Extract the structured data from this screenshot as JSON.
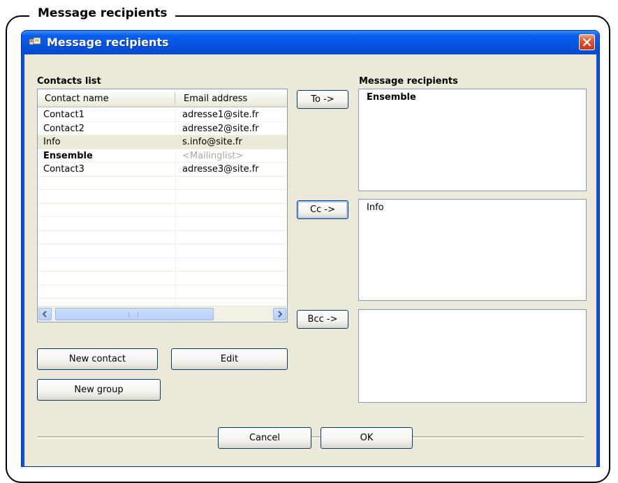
{
  "frame": {
    "caption": "Message recipients"
  },
  "window": {
    "title": "Message recipients"
  },
  "contacts": {
    "label": "Contacts list",
    "columns": [
      "Contact name",
      "Email address"
    ],
    "rows": [
      {
        "name": "Contact1",
        "email": "adresse1@site.fr"
      },
      {
        "name": "Contact2",
        "email": "adresse2@site.fr"
      },
      {
        "name": "Info",
        "email": "s.info@site.fr"
      },
      {
        "name": "Ensemble",
        "email": "<Mailinglist>"
      },
      {
        "name": "Contact3",
        "email": "adresse3@site.fr"
      }
    ],
    "scroll_grip": "IIII"
  },
  "buttons": {
    "new_contact": "New contact",
    "edit": "Edit",
    "new_group": "New group",
    "to": "To ->",
    "cc": "Cc ->",
    "bcc": "Bcc ->",
    "cancel": "Cancel",
    "ok": "OK"
  },
  "recipients": {
    "label": "Message recipients",
    "to": "Ensemble",
    "cc": "Info",
    "bcc": ""
  },
  "colors": {
    "titlebar": "#0554e3",
    "client": "#ece9d8",
    "close": "#e0552e"
  }
}
